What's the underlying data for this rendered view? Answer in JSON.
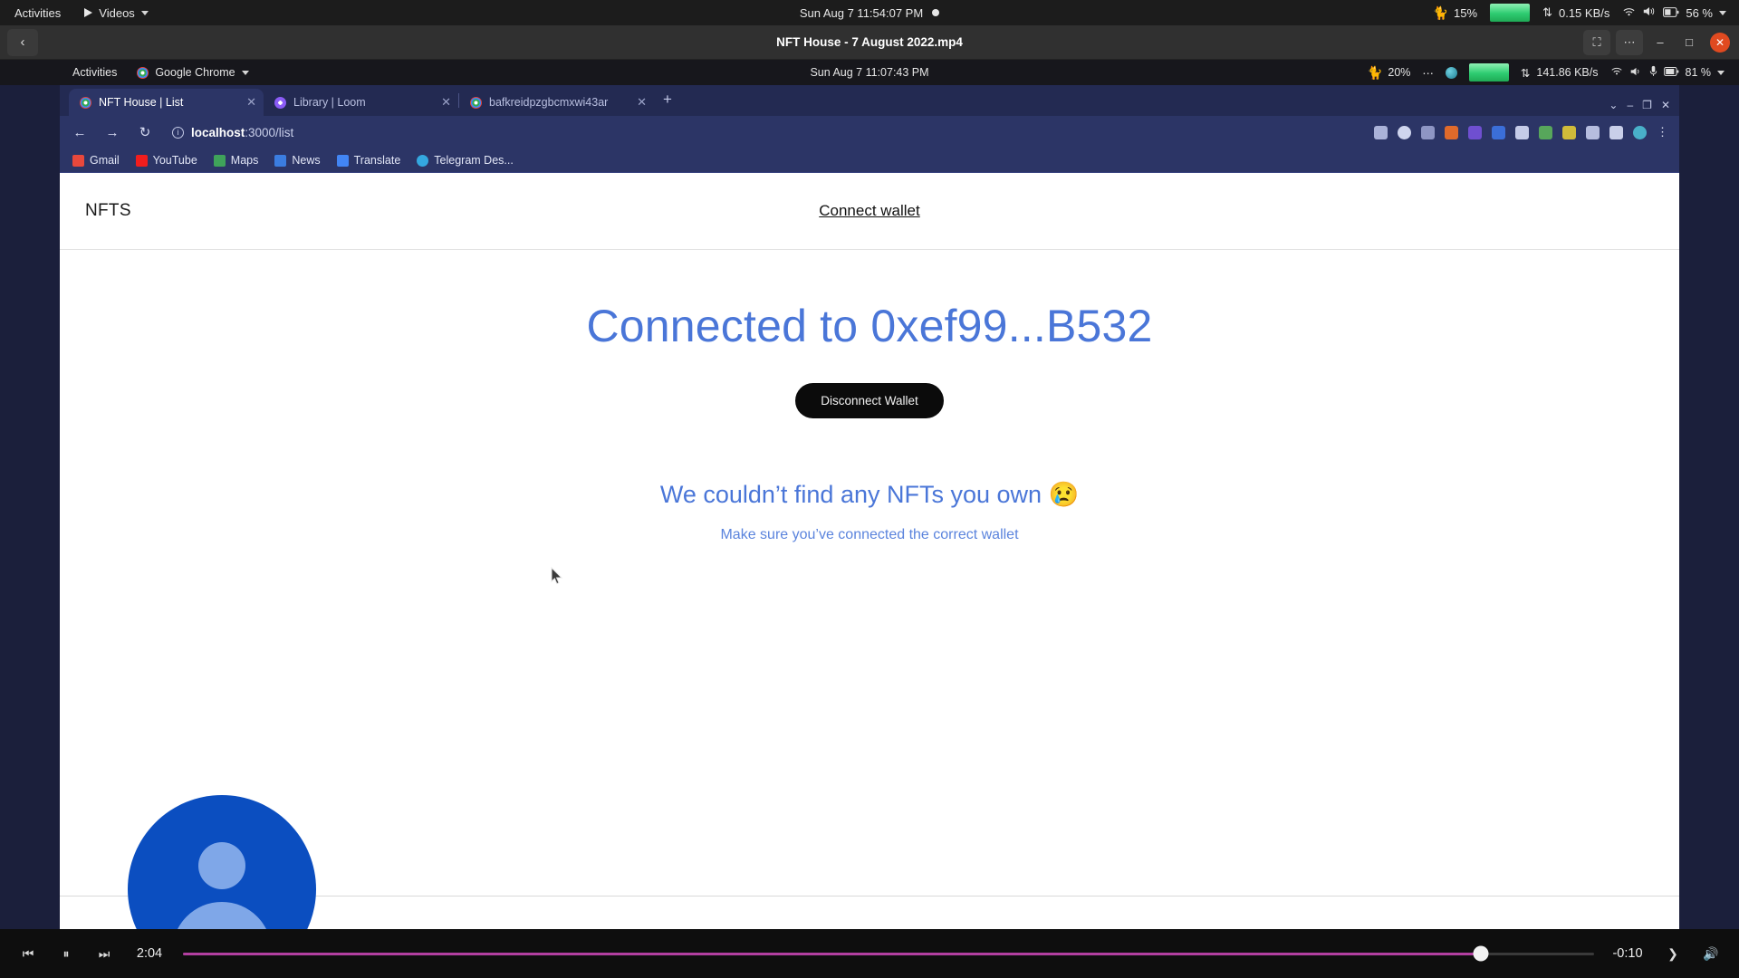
{
  "outer_topbar": {
    "activities": "Activities",
    "app_menu": "Videos",
    "clock": "Sun Aug 7  11:54:07 PM",
    "cpu_indicator": "15%",
    "network_speed": "0.15 KB/s",
    "battery": "56 %",
    "icons": [
      "play-icon",
      "chevron-down-icon",
      "recording-dot-icon",
      "runcat-icon",
      "network-bar-icon",
      "network-transfer-icon",
      "wifi-icon",
      "volume-icon",
      "battery-icon",
      "chevron-down-icon"
    ]
  },
  "player_window": {
    "title": "NFT House - 7 August 2022.mp4",
    "back_label": "‹",
    "fullscreen_label": "⛶",
    "menu_label": "⋯",
    "minimize_label": "–",
    "maximize_label": "□",
    "close_label": "✕"
  },
  "inner_topbar": {
    "activities": "Activities",
    "app_menu": "Google Chrome",
    "clock": "Sun Aug 7  11:07:43 PM",
    "cpu_indicator": "20%",
    "overflow": "⋯",
    "network_speed": "141.86 KB/s",
    "battery": "81 %"
  },
  "browser": {
    "tabs": [
      {
        "title": "NFT House | List",
        "favicon": "chrome-favicon",
        "active": true
      },
      {
        "title": "Library | Loom",
        "favicon": "loom-favicon",
        "active": false
      },
      {
        "title": "bafkreidpzgbcmxwi43ar",
        "favicon": "chrome-favicon",
        "active": false
      }
    ],
    "new_tab_label": "+",
    "window_minimize": "–",
    "window_maximize": "❐",
    "window_close": "✕",
    "window_chevron": "⌄",
    "nav": {
      "back": "←",
      "forward": "→",
      "reload": "↻"
    },
    "url_host": "localhost",
    "url_path": ":3000/list",
    "info_icon_label": "i",
    "bookmarks": [
      {
        "label": "Gmail",
        "color": "#e8483c"
      },
      {
        "label": "YouTube",
        "color": "#f21d1d"
      },
      {
        "label": "Maps",
        "color": "#3fa35a"
      },
      {
        "label": "News",
        "color": "#3b7de0"
      },
      {
        "label": "Translate",
        "color": "#4285f4"
      },
      {
        "label": "Telegram Des...",
        "color": "#34a8e0"
      }
    ],
    "toolbar_icons": [
      "share-icon",
      "bookmark-star-icon",
      "person-icon",
      "extension-orange-icon",
      "extension-purple-icon",
      "extension-blue-icon",
      "extension-grid-icon",
      "download-icon",
      "extension-green-icon",
      "puzzle-icon",
      "sidepanel-icon",
      "profile-avatar-icon",
      "kebab-menu-icon"
    ]
  },
  "site": {
    "brand": "NFTS",
    "connect_link": "Connect wallet",
    "hero_title": "Connected to 0xef99...B532",
    "disconnect_button": "Disconnect Wallet",
    "empty_title": "We couldn’t find any NFTs you own 😢",
    "empty_subtitle": "Make sure you’ve connected the correct wallet",
    "accent_color": "#4a76d8",
    "avatar_bubble_color": "#0b4ec0"
  },
  "player_controls": {
    "previous": "⏮",
    "pause": "⏸",
    "next_chapter": "⏭",
    "elapsed": "2:04",
    "remaining": "-0:10",
    "skip_forward": "❯",
    "volume": "🔊",
    "progress_percent": 92,
    "progress_color": "#b23fa0"
  }
}
